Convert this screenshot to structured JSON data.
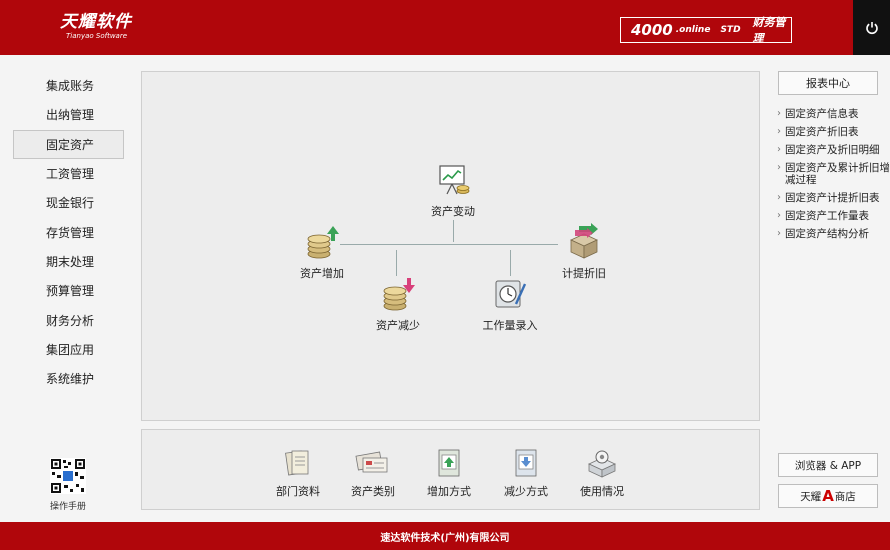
{
  "header": {
    "logo_cn": "天耀软件",
    "logo_en": "Tianyao Software",
    "product_number": "4000",
    "product_online": ".online",
    "product_edition": "STD",
    "product_title": "财务管理",
    "power_icon": "power-icon"
  },
  "sidebar": {
    "items": [
      {
        "label": "集成账务"
      },
      {
        "label": "出纳管理"
      },
      {
        "label": "固定资产",
        "active": true
      },
      {
        "label": "工资管理"
      },
      {
        "label": "现金银行"
      },
      {
        "label": "存货管理"
      },
      {
        "label": "期末处理"
      },
      {
        "label": "预算管理"
      },
      {
        "label": "财务分析"
      },
      {
        "label": "集团应用"
      },
      {
        "label": "系统维护"
      }
    ],
    "manual_label": "操作手册"
  },
  "flow": {
    "asset_change": "资产变动",
    "asset_increase": "资产增加",
    "asset_decrease": "资产减少",
    "workload_entry": "工作量录入",
    "depreciation": "计提折旧"
  },
  "settings": {
    "items": [
      {
        "label": "部门资料",
        "icon": "documents-icon"
      },
      {
        "label": "资产类别",
        "icon": "asset-category-icon"
      },
      {
        "label": "增加方式",
        "icon": "add-method-icon"
      },
      {
        "label": "减少方式",
        "icon": "reduce-method-icon"
      },
      {
        "label": "使用情况",
        "icon": "usage-icon"
      }
    ]
  },
  "right": {
    "report_center": "报表中心",
    "reports": [
      "固定资产信息表",
      "固定资产折旧表",
      "固定资产及折旧明细",
      "固定资产及累计折旧增减过程",
      "固定资产计提折旧表",
      "固定资产工作量表",
      "固定资产结构分析"
    ],
    "browser_app": "浏览器 & APP",
    "store_prefix": "天耀",
    "store_letter": "A",
    "store_suffix": "商店"
  },
  "footer": {
    "company": "速达软件技术(广州)有限公司"
  },
  "colors": {
    "brand_red": "#b0060b",
    "power_bg": "#111111"
  }
}
